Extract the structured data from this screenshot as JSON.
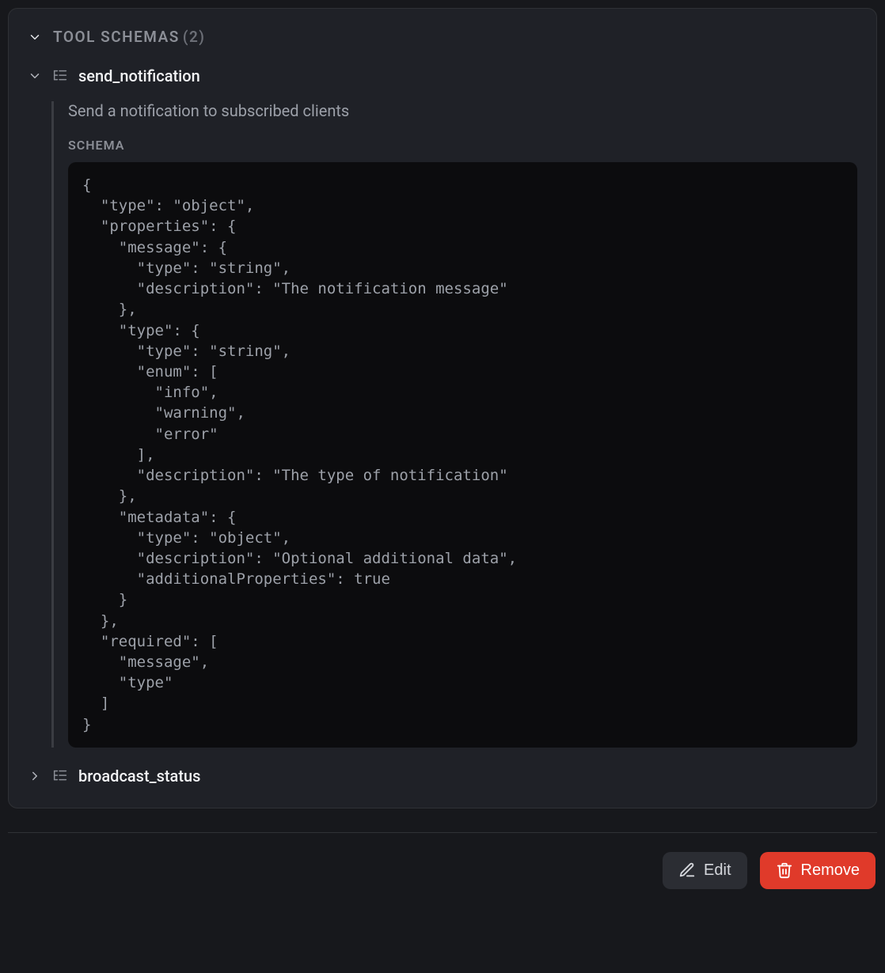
{
  "section": {
    "title": "TOOL SCHEMAS",
    "count": "(2)"
  },
  "tools": [
    {
      "name": "send_notification",
      "expanded": true,
      "description": "Send a notification to subscribed clients",
      "schema_label": "SCHEMA",
      "schema_json": "{\n  \"type\": \"object\",\n  \"properties\": {\n    \"message\": {\n      \"type\": \"string\",\n      \"description\": \"The notification message\"\n    },\n    \"type\": {\n      \"type\": \"string\",\n      \"enum\": [\n        \"info\",\n        \"warning\",\n        \"error\"\n      ],\n      \"description\": \"The type of notification\"\n    },\n    \"metadata\": {\n      \"type\": \"object\",\n      \"description\": \"Optional additional data\",\n      \"additionalProperties\": true\n    }\n  },\n  \"required\": [\n    \"message\",\n    \"type\"\n  ]\n}"
    },
    {
      "name": "broadcast_status",
      "expanded": false
    }
  ],
  "actions": {
    "edit": "Edit",
    "remove": "Remove"
  }
}
